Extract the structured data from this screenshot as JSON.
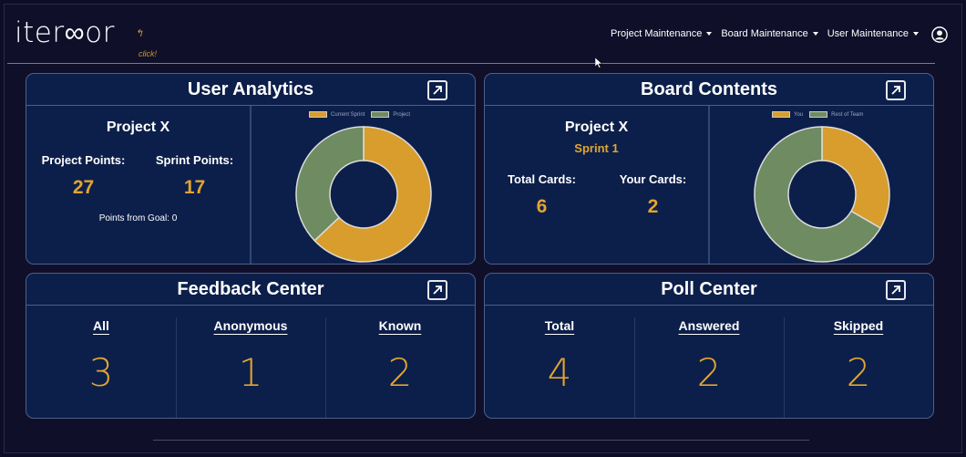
{
  "app": {
    "logo": "iter∞or",
    "click_hint": "click!"
  },
  "nav": {
    "items": [
      {
        "label": "Project Maintenance"
      },
      {
        "label": "Board Maintenance"
      },
      {
        "label": "User Maintenance"
      }
    ]
  },
  "colors": {
    "background": "#100f2a",
    "card": "#0c1f4a",
    "accent_gold": "#e2a530",
    "series_green": "#6e8b62",
    "series_gold": "#d89d2c"
  },
  "user_analytics": {
    "title": "User Analytics",
    "project": "Project X",
    "project_points_label": "Project Points:",
    "project_points": "27",
    "sprint_points_label": "Sprint Points:",
    "sprint_points": "17",
    "points_from_goal": "Points from Goal: 0",
    "legend": [
      "Current Sprint",
      "Project"
    ]
  },
  "board_contents": {
    "title": "Board Contents",
    "project": "Project X",
    "sprint": "Sprint 1",
    "total_cards_label": "Total Cards:",
    "total_cards": "6",
    "your_cards_label": "Your Cards:",
    "your_cards": "2",
    "legend": [
      "You",
      "Rest of Team"
    ]
  },
  "feedback_center": {
    "title": "Feedback Center",
    "columns": [
      {
        "label": "All",
        "value": "3"
      },
      {
        "label": "Anonymous",
        "value": "1"
      },
      {
        "label": "Known",
        "value": "2"
      }
    ]
  },
  "poll_center": {
    "title": "Poll Center",
    "columns": [
      {
        "label": "Total",
        "value": "4"
      },
      {
        "label": "Answered",
        "value": "2"
      },
      {
        "label": "Skipped",
        "value": "2"
      }
    ]
  },
  "chart_data": [
    {
      "type": "pie",
      "variant": "donut",
      "labels": [
        "Current Sprint",
        "Project"
      ],
      "values": [
        17,
        10
      ],
      "colors": [
        "#d89d2c",
        "#6e8b62"
      ]
    },
    {
      "type": "pie",
      "variant": "donut",
      "labels": [
        "You",
        "Rest of Team"
      ],
      "values": [
        2,
        4
      ],
      "colors": [
        "#d89d2c",
        "#6e8b62"
      ]
    }
  ]
}
